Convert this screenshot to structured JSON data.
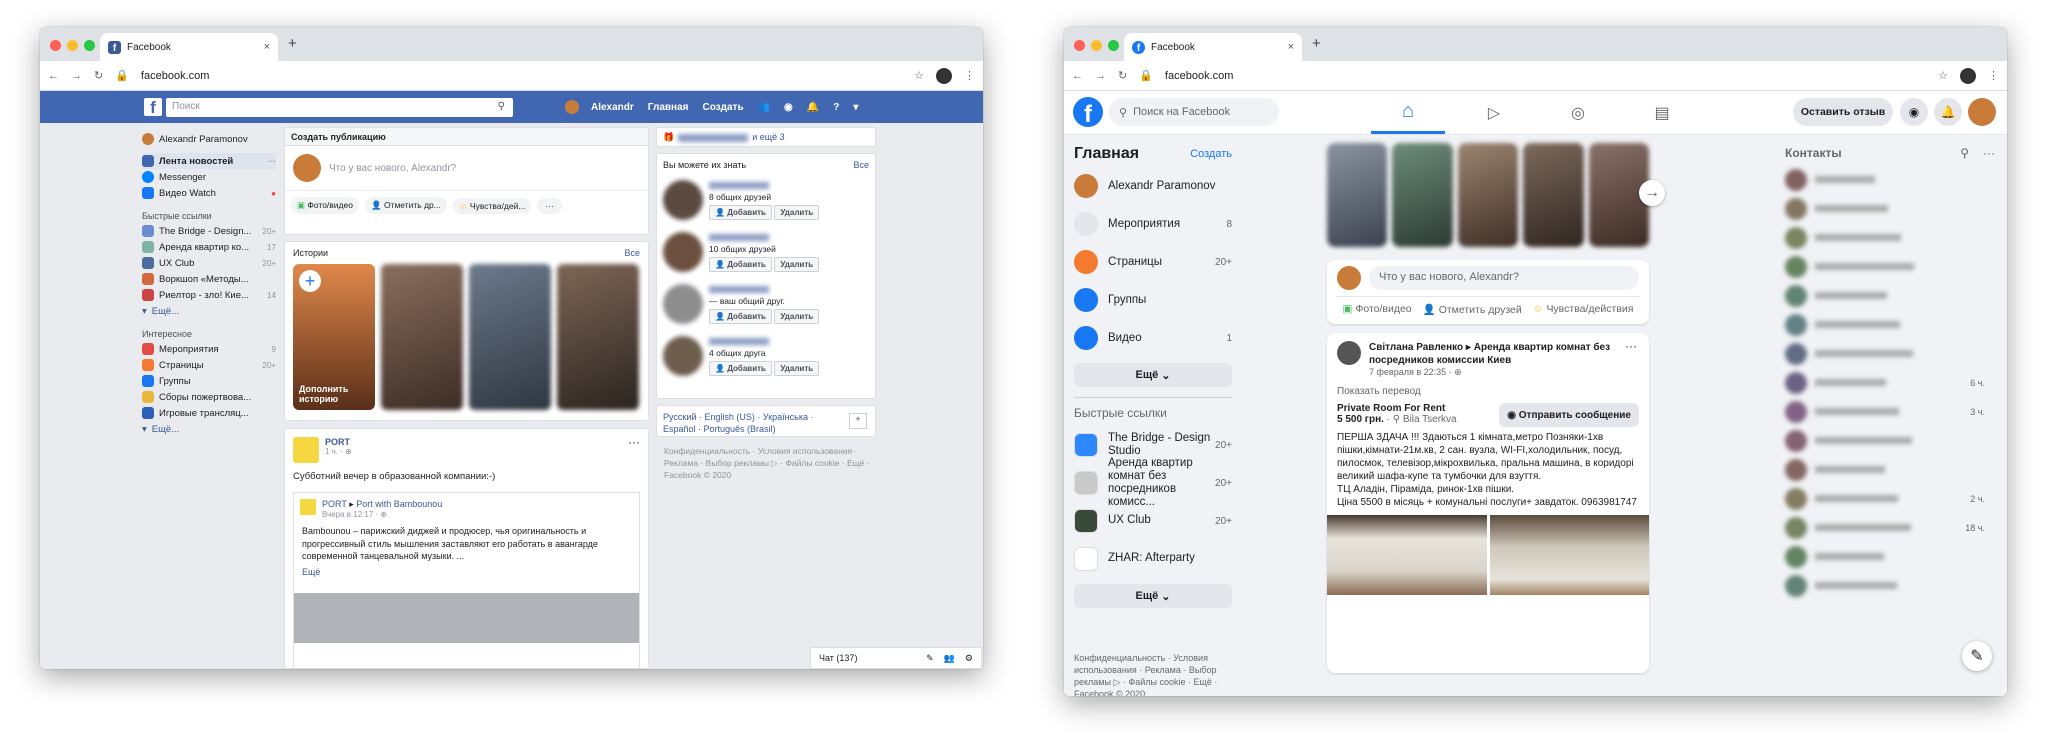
{
  "browser": {
    "tab_title": "Facebook",
    "url": "facebook.com",
    "new_tab": "+",
    "close": "×"
  },
  "classic": {
    "search_placeholder": "Поиск",
    "nav": {
      "user": "Alexandr",
      "home": "Главная",
      "create": "Создать"
    },
    "left": {
      "profile": "Alexandr Paramonov",
      "main_items": [
        {
          "label": "Лента новостей",
          "extra": "···"
        },
        {
          "label": "Messenger"
        },
        {
          "label": "Видео Watch"
        }
      ],
      "quick_links_header": "Быстрые ссылки",
      "quick_links": [
        {
          "label": "The Bridge - Design...",
          "count": "20+"
        },
        {
          "label": "Аренда квартир ко...",
          "count": "17"
        },
        {
          "label": "UX Club",
          "count": "20+"
        },
        {
          "label": "Воркшоп «Методы...",
          "count": ""
        },
        {
          "label": "Риелтор - зло! Кие...",
          "count": "14"
        }
      ],
      "more1": "Ещё...",
      "interests_header": "Интересное",
      "interests": [
        {
          "label": "Мероприятия",
          "count": "9"
        },
        {
          "label": "Страницы",
          "count": "20+"
        },
        {
          "label": "Группы",
          "count": ""
        },
        {
          "label": "Сборы пожертвова...",
          "count": ""
        },
        {
          "label": "Игровые трансляц...",
          "count": ""
        }
      ],
      "more2": "Ещё..."
    },
    "composer": {
      "header": "Создать публикацию",
      "placeholder": "Что у вас нового, Alexandr?",
      "photo": "Фото/видео",
      "tag": "Отметить др...",
      "feeling": "Чувства/дей...",
      "more": "···"
    },
    "stories": {
      "title": "Истории",
      "all": "Все",
      "add_label": "Дополнить историю",
      "plus": "+"
    },
    "post": {
      "page": "PORT",
      "time": "1 ч. · ",
      "text": "Субботний вечер в образованной компании:-)",
      "menu": "···",
      "shared_from": "PORT",
      "shared_arrow": "▸",
      "shared_to": "Port with Bambounou",
      "shared_time": "Вчера в 12:17 · ",
      "shared_text": "Bambounou – парижский диджей и продюсер, чья оригинальность и прогрессивный стиль мышления заставляют его работать в авангарде современной танцевальной музыки. ...",
      "shared_more": "Ещё"
    },
    "right": {
      "birthday_more": "и ещё 3",
      "pymk_title": "Вы можете их знать",
      "pymk_all": "Все",
      "pymk": [
        {
          "sub": "8 общих друзей"
        },
        {
          "sub": "10 общих друзей"
        },
        {
          "sub": "— ваш общий друг."
        },
        {
          "sub": "4 общих друга"
        }
      ],
      "add": "Добавить",
      "remove": "Удалить",
      "languages": "Русский · English (US) · Українська · Español · Português (Brasil)",
      "lang_plus": "+",
      "footer": "Конфиденциальность · Условия использования · Реклама · Выбор рекламы ▷ · Файлы cookie · Ещё · Facebook © 2020"
    },
    "chat": {
      "label": "Чат (137)"
    }
  },
  "modern": {
    "search_placeholder": "Поиск на Facebook",
    "feedback_btn": "Оставить отзыв",
    "left": {
      "title": "Главная",
      "create": "Создать",
      "profile": "Alexandr Paramonov",
      "items": [
        {
          "label": "Мероприятия",
          "count": "8"
        },
        {
          "label": "Страницы",
          "count": "20+"
        },
        {
          "label": "Группы",
          "count": ""
        },
        {
          "label": "Видео",
          "count": "1"
        }
      ],
      "more": "Ещё",
      "quick_header": "Быстрые ссылки",
      "quick": [
        {
          "label": "The Bridge - Design Studio",
          "count": "20+"
        },
        {
          "label": "Аренда квартир комнат без посредников комисс...",
          "count": "20+"
        },
        {
          "label": "UX Club",
          "count": "20+"
        },
        {
          "label": "ZHAR: Afterparty",
          "count": ""
        }
      ],
      "more2": "Ещё",
      "footer": "Конфиденциальность · Условия использования · Реклама · Выбор рекламы ▷ · Файлы cookie · Ещё · Facebook © 2020"
    },
    "composer": {
      "placeholder": "Что у вас нового, Alexandr?",
      "photo": "Фото/видео",
      "tag": "Отметить друзей",
      "feeling": "Чувства/действия"
    },
    "post": {
      "author": "Світлана Равленко",
      "arrow": "▸",
      "group": "Аренда квартир комнат без посредников комиссии Киев",
      "time": "7 февраля в 22:35 · ",
      "translate": "Показать перевод",
      "menu": "···",
      "listing_title": "Private Room For Rent",
      "price": "5 500 грн.",
      "location": " · ⚲ Bila Tserkva",
      "send_btn": "Отправить сообщение",
      "text": "ПЕРША ЗДАЧА !!! Здаються 1 кімната,метро Позняки-1хв пішки,кімнати-21м.кв, 2 сан. вузла, WI-FI,холодильник, посуд, пилосмок, телевізор,мікрохвилька, пральна машина, в коридорі великий шафа-купе та тумбочки для взуття.\nТЦ Аладін, Піраміда, ринок-1хв пішки.\nЦіна 5500 в місяць + комунальні послуги+ завдаток. 0963981747"
    },
    "contacts": {
      "title": "Контакты",
      "counts": [
        "",
        "",
        "",
        "",
        "",
        "",
        "",
        "6 ч.",
        "3 ч.",
        "",
        "",
        "2 ч.",
        "18 ч.",
        "",
        ""
      ]
    },
    "colors": {
      "blue": "#1877f2",
      "classic_blue": "#4267b2"
    }
  }
}
